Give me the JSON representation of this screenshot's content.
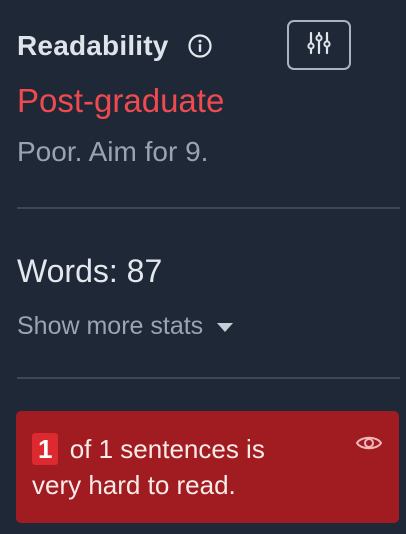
{
  "header": {
    "title": "Readability",
    "info_icon": "info-icon",
    "settings_icon": "sliders-icon"
  },
  "score": {
    "grade": "Post-graduate",
    "grade_color": "#ef4a4f",
    "hint": "Poor. Aim for 9."
  },
  "stats": {
    "words": "Words: 87",
    "show_more_label": "Show more stats",
    "show_more_icon": "caret-down-icon"
  },
  "alert": {
    "count": "1",
    "text_line1": "of 1 sentences is",
    "text_line2": "very hard to read.",
    "background": "#a01c20",
    "badge_color": "#dc2a30",
    "visibility_icon": "eye-icon"
  }
}
